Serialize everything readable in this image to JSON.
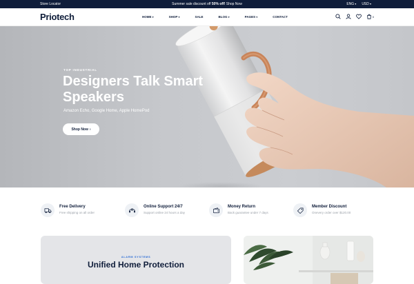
{
  "topbar": {
    "store_locator": "Store Locator",
    "promo_prefix": "Summer sale discount off ",
    "promo_bold": "50% off!",
    "promo_suffix": " Shop Now",
    "language": "ENG",
    "currency": "USD"
  },
  "header": {
    "logo": "Priotech",
    "nav": [
      "HOME",
      "SHOP",
      "SALE",
      "BLOG",
      "PAGES",
      "CONTACT"
    ],
    "cart_count": "0"
  },
  "hero": {
    "kicker": "TOP INDUSTRIAL",
    "title": "Designers Talk Smart Speakers",
    "subtitle": "Amazon Echo, Google Home, Apple HomePod",
    "cta": "Shop Now"
  },
  "features": [
    {
      "title": "Free Delivery",
      "desc": "Free shipping on all order",
      "icon": "truck-icon"
    },
    {
      "title": "Online Support 24/7",
      "desc": "Support online 24 hours a day",
      "icon": "headset-icon"
    },
    {
      "title": "Money Return",
      "desc": "Back guarantee under 7 days",
      "icon": "wallet-icon"
    },
    {
      "title": "Member Discount",
      "desc": "Onevery order over $120.00",
      "icon": "tag-icon"
    }
  ],
  "banner": {
    "kicker": "ALARM SYSTEMS",
    "title": "Unified Home Protection"
  },
  "colors": {
    "navy": "#0f1d3a",
    "accent_blue": "#2f6fd6",
    "hero_bg": "#c6c8cc"
  }
}
